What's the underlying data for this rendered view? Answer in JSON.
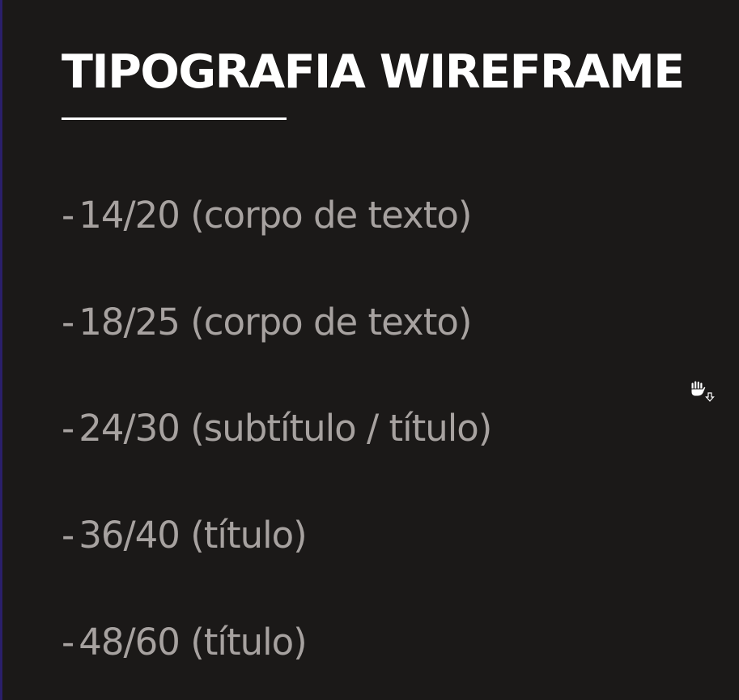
{
  "slide": {
    "title": "TIPOGRAFIA WIREFRAME",
    "items": [
      {
        "dash": "-",
        "text": "14/20 (corpo de texto)"
      },
      {
        "dash": "-",
        "text": "18/25 (corpo de texto)"
      },
      {
        "dash": "-",
        "text": "24/30 (subtítulo / título)"
      },
      {
        "dash": "-",
        "text": "36/40 (título)"
      },
      {
        "dash": "-",
        "text": "48/60 (título)"
      }
    ]
  },
  "colors": {
    "background": "#1b1918",
    "title": "#ffffff",
    "item_text": "#a7a2a0"
  },
  "cursor": {
    "icon": "grab-hand-cursor-icon"
  }
}
